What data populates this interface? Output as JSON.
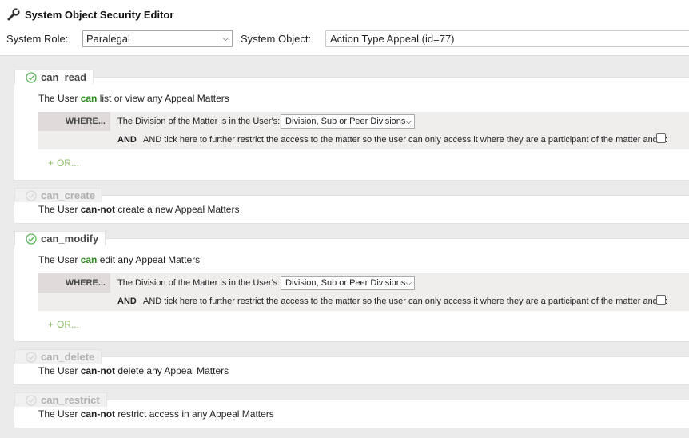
{
  "header": {
    "title": "System Object Security Editor",
    "icon": "wrench-icon",
    "role_label": "System Role:",
    "role_value": "Paralegal",
    "object_label": "System Object:",
    "object_value": "Action Type Appeal (id=77)"
  },
  "permissions": {
    "read": {
      "tab": "can_read",
      "enabled": true,
      "desc_prefix": "The User ",
      "desc_verb": "can",
      "desc_suffix": " list or view any Appeal Matters",
      "where_label": "WHERE...",
      "where_text": "The Division of the Matter is in the User's:",
      "where_select": "Division, Sub or Peer Divisions",
      "and_label": "AND",
      "and_text": "AND tick here to further restrict the access to the matter so the user can only access it where they are a participant of the matter and...:",
      "or_label": "OR..."
    },
    "create": {
      "tab": "can_create",
      "enabled": false,
      "desc_prefix": "The User ",
      "desc_verb": "can-not",
      "desc_suffix": " create a new Appeal Matters"
    },
    "modify": {
      "tab": "can_modify",
      "enabled": true,
      "desc_prefix": "The User ",
      "desc_verb": "can",
      "desc_suffix": " edit any Appeal Matters",
      "where_label": "WHERE...",
      "where_text": "The Division of the Matter is in the User's:",
      "where_select": "Division, Sub or Peer Divisions",
      "and_label": "AND",
      "and_text": "AND tick here to further restrict the access to the matter so the user can only access it where they are a participant of the matter and...:",
      "or_label": "OR..."
    },
    "delete": {
      "tab": "can_delete",
      "enabled": false,
      "desc_prefix": "The User ",
      "desc_verb": "can-not",
      "desc_suffix": " delete any Appeal Matters"
    },
    "restrict": {
      "tab": "can_restrict",
      "enabled": false,
      "desc_prefix": "The User ",
      "desc_verb": "can-not",
      "desc_suffix": " restrict access in any Appeal Matters"
    }
  },
  "colors": {
    "allowed": "#2e8b1e",
    "or_link": "#8bbd63",
    "check_green": "#5cb85c"
  }
}
